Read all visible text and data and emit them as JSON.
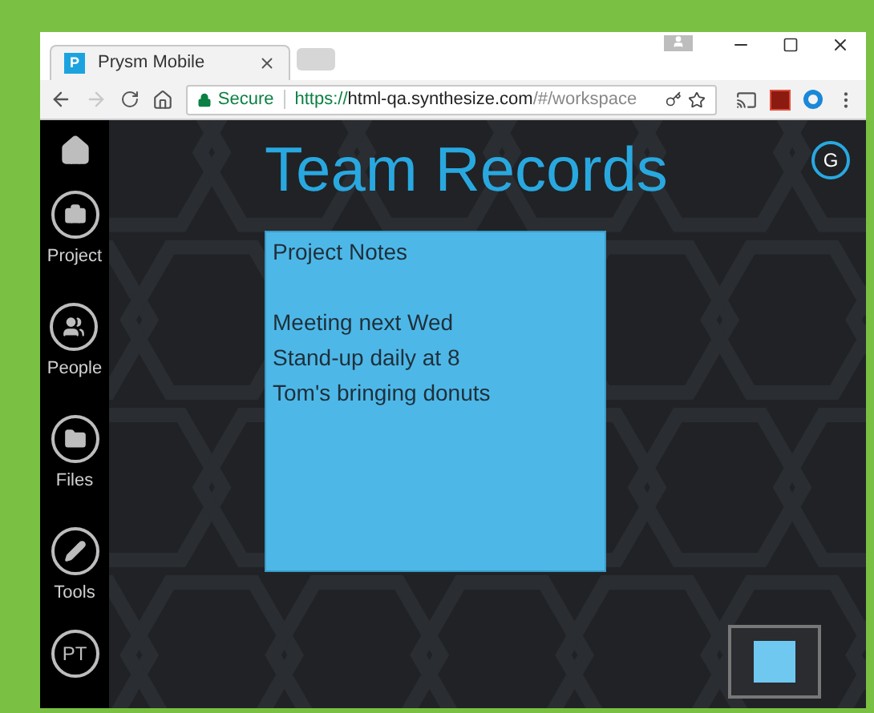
{
  "browser": {
    "tab": {
      "title": "Prysm Mobile",
      "favicon": "P"
    },
    "address": {
      "secure_label": "Secure",
      "scheme": "https://",
      "host": "html-qa.synthesize.com",
      "path": "/#/workspace"
    }
  },
  "sidebar": {
    "items": [
      {
        "kind": "home"
      },
      {
        "kind": "project",
        "label": "Project"
      },
      {
        "kind": "people",
        "label": "People"
      },
      {
        "kind": "files",
        "label": "Files"
      },
      {
        "kind": "tools",
        "label": "Tools"
      },
      {
        "kind": "initials",
        "label": "PT"
      }
    ]
  },
  "page": {
    "title": "Team Records",
    "avatar": "G"
  },
  "note": {
    "title": "Project Notes",
    "lines": [
      "Meeting next Wed",
      "Stand-up daily at 8",
      "Tom's bringing donuts"
    ]
  }
}
